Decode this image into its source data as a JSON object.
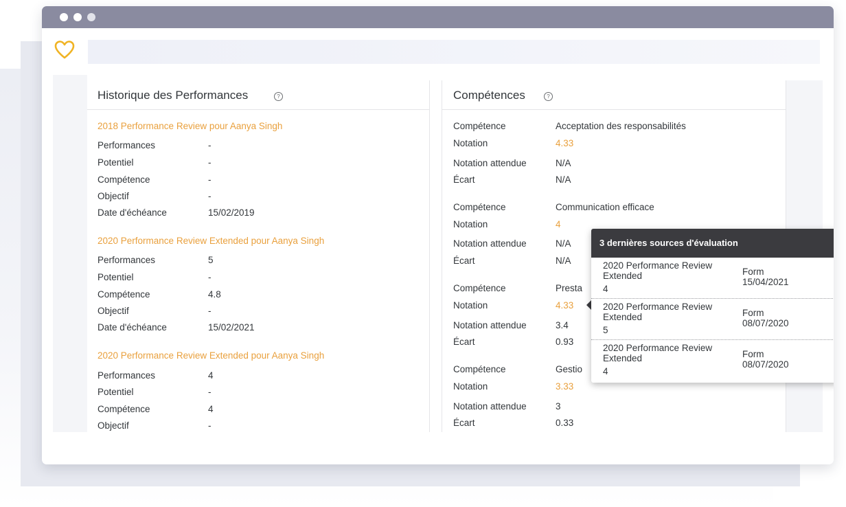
{
  "history": {
    "title": "Historique des Performances",
    "reviews": [
      {
        "title": "2018 Performance Review pour Aanya Singh",
        "rows": [
          {
            "label": "Performances",
            "value": "-"
          },
          {
            "label": "Potentiel",
            "value": "-"
          },
          {
            "label": "Compétence",
            "value": "-"
          },
          {
            "label": "Objectif",
            "value": "-"
          },
          {
            "label": "Date d'échéance",
            "value": "15/02/2019"
          }
        ]
      },
      {
        "title": "2020 Performance Review Extended pour Aanya Singh",
        "rows": [
          {
            "label": "Performances",
            "value": "5"
          },
          {
            "label": "Potentiel",
            "value": "-"
          },
          {
            "label": "Compétence",
            "value": "4.8"
          },
          {
            "label": "Objectif",
            "value": "-"
          },
          {
            "label": "Date d'échéance",
            "value": "15/02/2021"
          }
        ]
      },
      {
        "title": "2020 Performance Review Extended pour Aanya Singh",
        "rows": [
          {
            "label": "Performances",
            "value": "4"
          },
          {
            "label": "Potentiel",
            "value": "-"
          },
          {
            "label": "Compétence",
            "value": "4"
          },
          {
            "label": "Objectif",
            "value": "-"
          }
        ]
      }
    ]
  },
  "competences": {
    "title": "Compétences",
    "labels": {
      "competence": "Compétence",
      "notation": "Notation",
      "expected": "Notation attendue",
      "gap": "Écart"
    },
    "items": [
      {
        "name": "Acceptation des responsabilités",
        "rating": "4.33",
        "expected": "N/A",
        "gap": "N/A"
      },
      {
        "name": "Communication efficace",
        "rating": "4",
        "expected": "N/A",
        "gap": "N/A"
      },
      {
        "name": "Presta",
        "rating": "4.33",
        "expected": "3.4",
        "gap": "0.93"
      },
      {
        "name": "Gestio",
        "rating": "3.33",
        "expected": "3",
        "gap": "0.33"
      }
    ]
  },
  "popover": {
    "title": "3 dernières sources d'évaluation",
    "rows": [
      {
        "name": "2020 Performance Review Extended",
        "score": "4",
        "source": "Form",
        "date": "15/04/2021"
      },
      {
        "name": "2020 Performance Review Extended",
        "score": "5",
        "source": "Form",
        "date": "08/07/2020"
      },
      {
        "name": "2020 Performance Review Extended",
        "score": "4",
        "source": "Form",
        "date": "08/07/2020"
      }
    ]
  },
  "colors": {
    "accent": "#e9a03d",
    "titlebar": "#8a8ba0",
    "popover_header": "#3b3b3f"
  },
  "icons": {
    "logo": "heart-icon",
    "help": "help-icon"
  }
}
